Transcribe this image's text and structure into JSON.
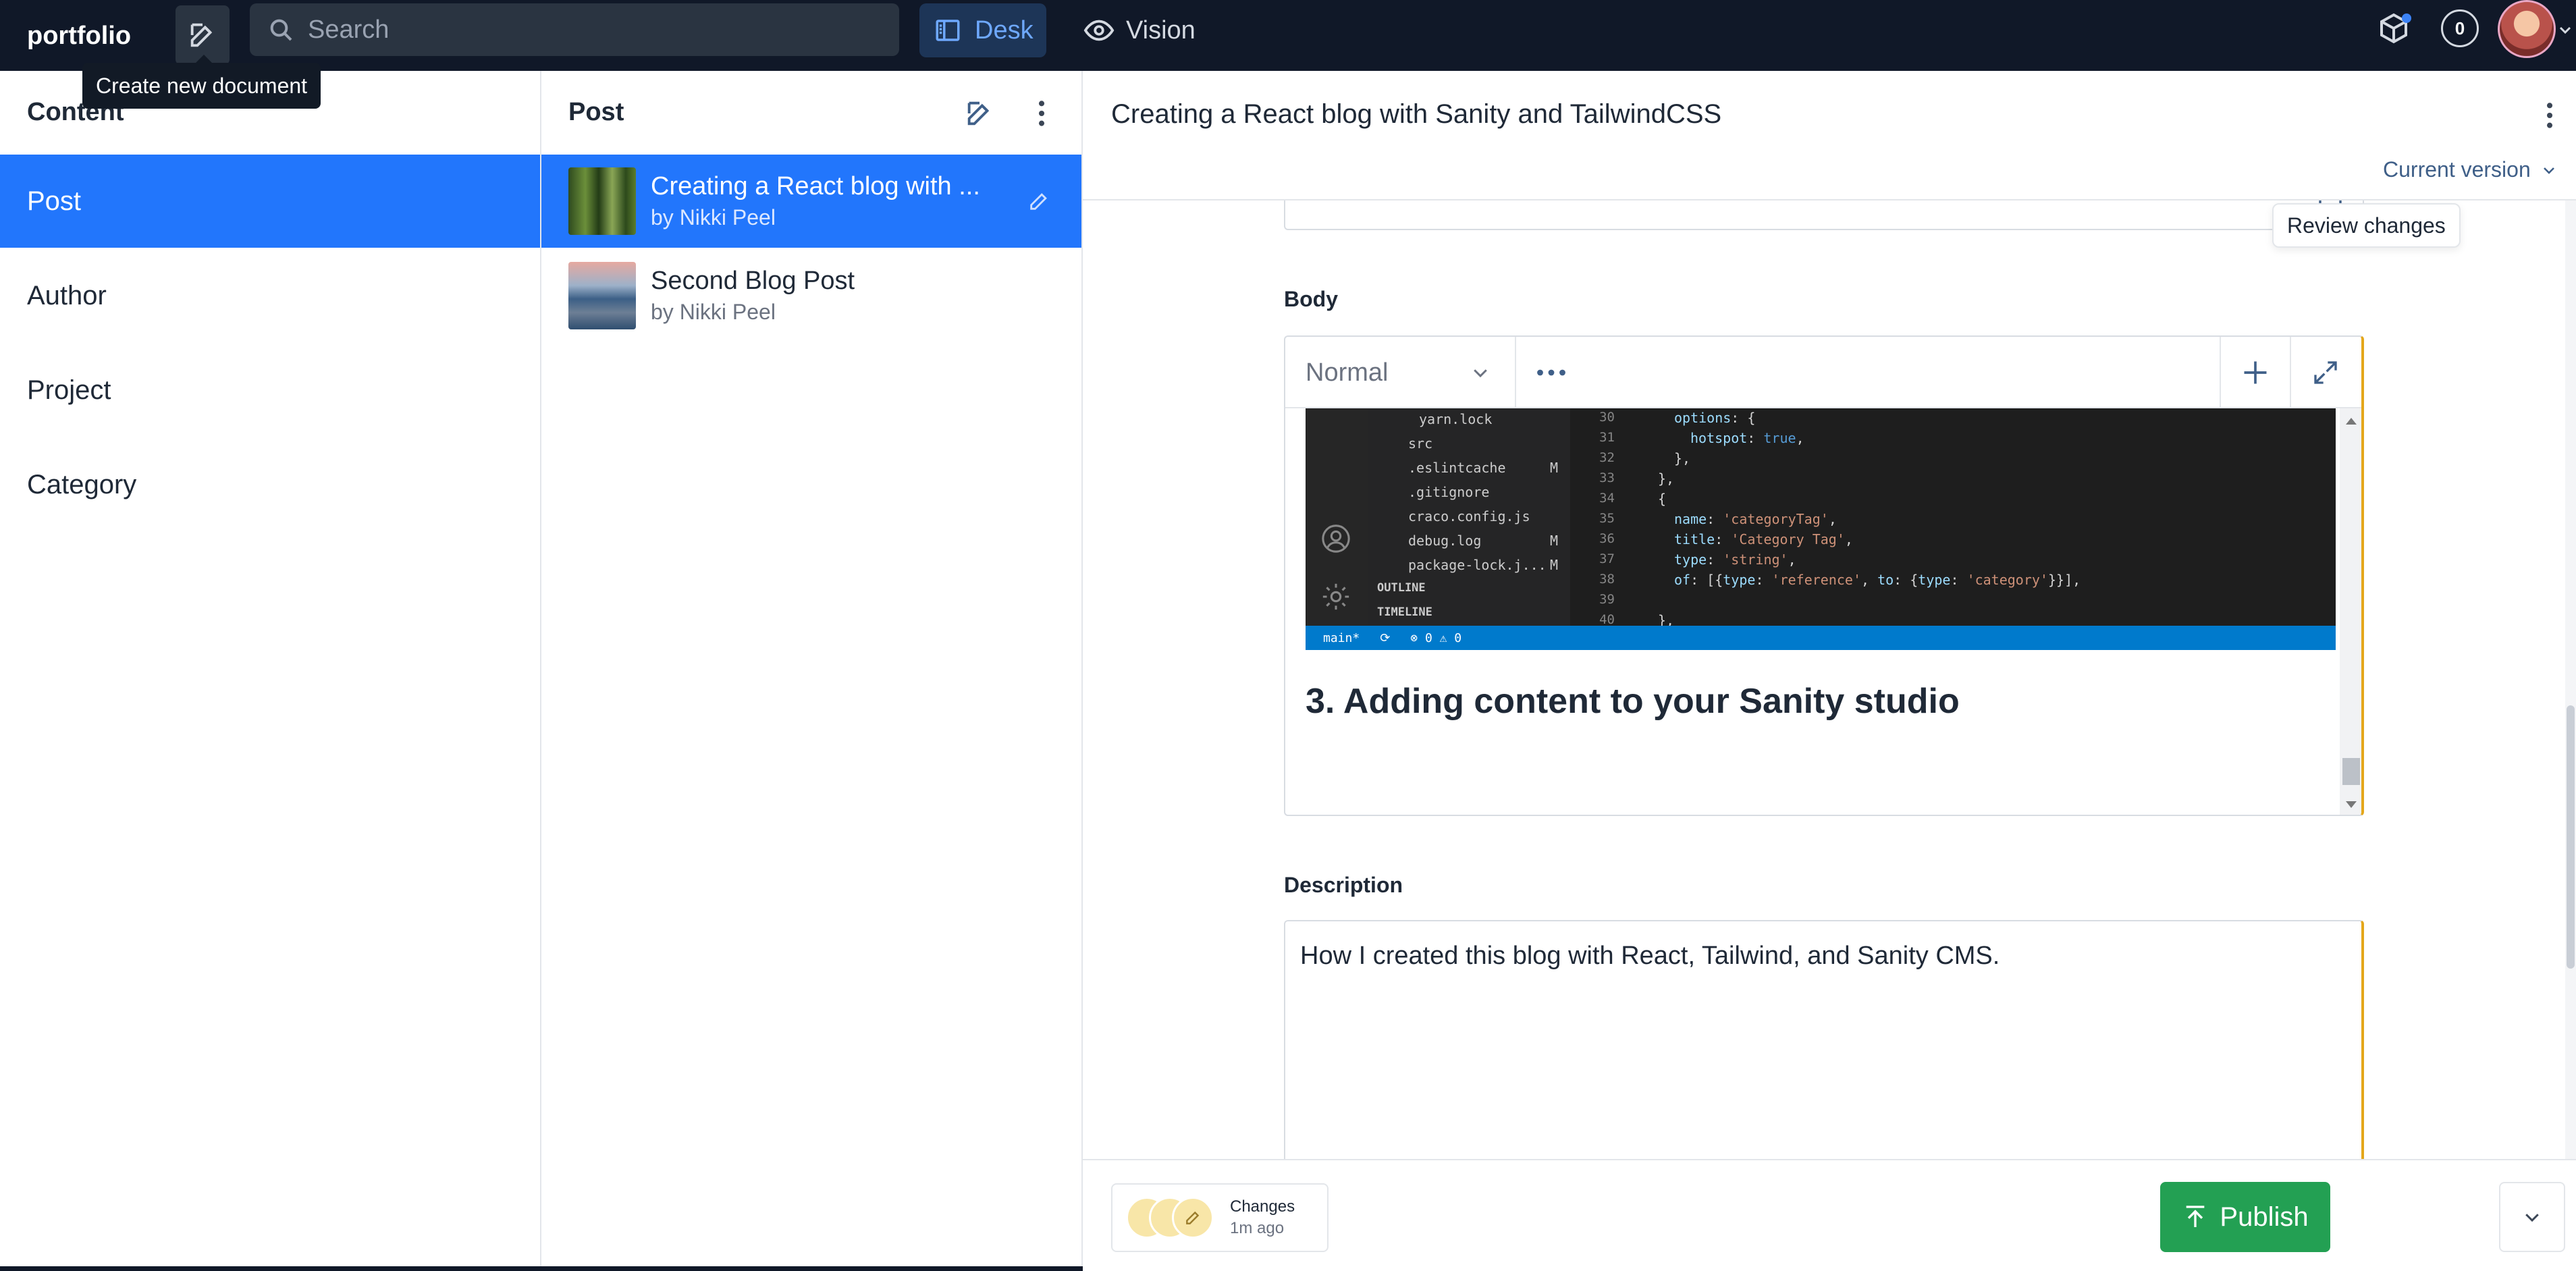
{
  "app": {
    "brand": "portfolio",
    "search_placeholder": "Search"
  },
  "tools": {
    "desk": "Desk",
    "vision": "Vision"
  },
  "notifications": {
    "count": "0"
  },
  "tooltips": {
    "create_new_document": "Create new document",
    "review_changes": "Review changes"
  },
  "content_pane": {
    "title": "Content",
    "items": [
      {
        "label": "Post"
      },
      {
        "label": "Author"
      },
      {
        "label": "Project"
      },
      {
        "label": "Category"
      }
    ]
  },
  "post_pane": {
    "title": "Post",
    "posts": [
      {
        "title": "Creating a React blog with ...",
        "author": "by Nikki Peel"
      },
      {
        "title": "Second Blog Post",
        "author": "by Nikki Peel"
      }
    ]
  },
  "document": {
    "title": "Creating a React blog with Sanity and TailwindCSS",
    "version_label": "Current version",
    "body_label": "Body",
    "style_select": "Normal",
    "embedded_code": {
      "tree": [
        "yarn.lock",
        "src",
        ".eslintcache",
        ".gitignore",
        "craco.config.js",
        "debug.log",
        "package-lock.j...",
        "OUTLINE",
        "TIMELINE"
      ],
      "line_numbers": [
        "30",
        "31",
        "32",
        "33",
        "34",
        "35",
        "36",
        "37",
        "38",
        "39",
        "40"
      ],
      "status_branch": "main*",
      "status_problems": "⊗ 0 ⚠ 0"
    },
    "body_heading": "3. Adding content to your Sanity studio",
    "description_label": "Description",
    "description_value": "How I created this blog with React, Tailwind, and Sanity CMS."
  },
  "footer": {
    "changes_label": "Changes",
    "changes_time": "1m ago",
    "publish_label": "Publish"
  },
  "colors": {
    "navbar": "#101828",
    "selected": "#2276fc",
    "publish": "#23a053",
    "changed_border": "#e4a71b"
  }
}
